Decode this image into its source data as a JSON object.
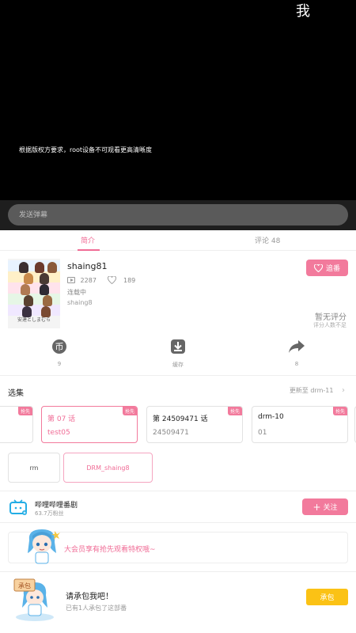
{
  "player": {
    "corner_text": "我",
    "notice": "根据版权方要求，root设备不可观看更高清晰度"
  },
  "danmaku": {
    "placeholder": "发送弹幕"
  },
  "tabs": [
    {
      "label": "简介",
      "active": true
    },
    {
      "label": "评论 48",
      "active": false
    }
  ],
  "info": {
    "title": "shaing81",
    "plays": "2287",
    "likes": "189",
    "status": "连载中",
    "subtitle": "shaing8",
    "follow_label": "追番",
    "score_text": "暂无评分",
    "score_sub": "评分人数不足"
  },
  "poster": {
    "logo_text": "安達としまむら"
  },
  "actions": [
    {
      "icon": "coin-icon",
      "label": "9"
    },
    {
      "icon": "download-icon",
      "label": "缓存"
    },
    {
      "icon": "share-icon",
      "label": "8"
    }
  ],
  "episodes_section": {
    "title": "选集",
    "update_text": "更新至 drm-11"
  },
  "episodes": [
    {
      "name": "",
      "code": "",
      "tag": "抢先",
      "active": false
    },
    {
      "name": "第 07 话",
      "code": "test05",
      "tag": "抢先",
      "active": true
    },
    {
      "name": "第 24509471 话",
      "code": "24509471",
      "tag": "抢先",
      "active": false
    },
    {
      "name": "drm-10",
      "code": "01",
      "tag": "抢先",
      "active": false
    }
  ],
  "seasons": [
    {
      "label": "rm",
      "active": false
    },
    {
      "label": "DRM_shaing8",
      "active": true
    }
  ],
  "channel": {
    "name": "哔哩哔哩番剧",
    "fans": "63.7万粉丝",
    "follow_label": "关注"
  },
  "banner": {
    "text": "大会员享有抢先观看特权哦~"
  },
  "sponsor": {
    "title": "请承包我吧！",
    "sub": "已有1人承包了这部番",
    "button": "承包",
    "sign_text": "承包"
  },
  "colors": {
    "accent": "#f27a9c",
    "accent_text": "#f06c96",
    "sponsor": "#fbc215"
  }
}
